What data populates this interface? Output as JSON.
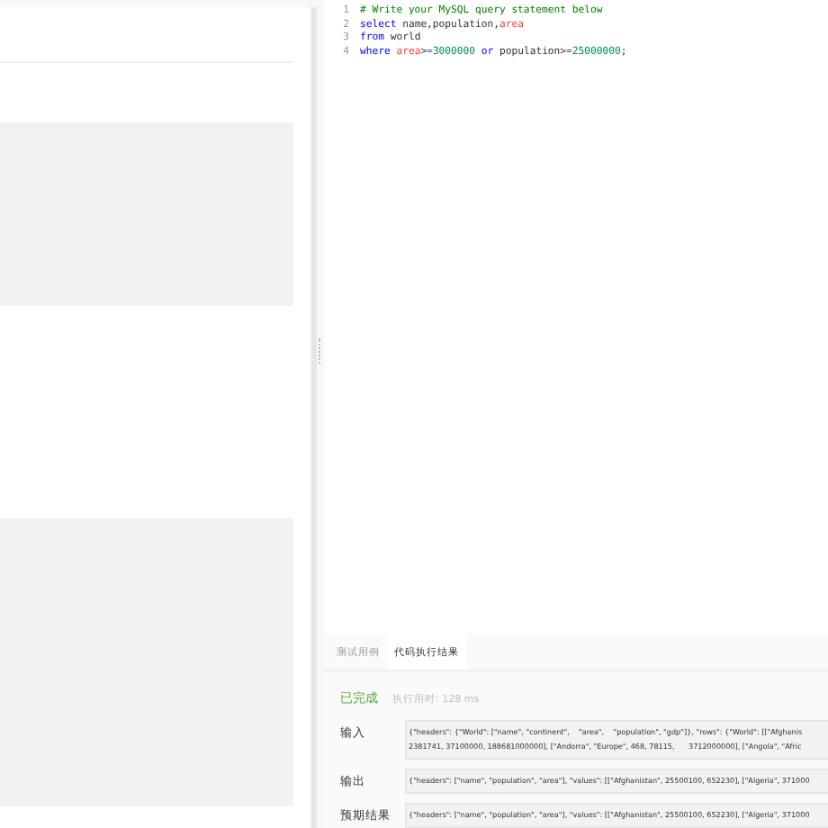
{
  "editor": {
    "lines": [
      {
        "number": "1",
        "tokens": [
          {
            "kind": "comment",
            "text": "# Write your MySQL query statement below"
          }
        ]
      },
      {
        "number": "2",
        "tokens": [
          {
            "kind": "keyword",
            "text": "select"
          },
          {
            "kind": "plain",
            "text": " name,population,"
          },
          {
            "kind": "column",
            "text": "area"
          }
        ]
      },
      {
        "number": "3",
        "tokens": [
          {
            "kind": "keyword",
            "text": "from"
          },
          {
            "kind": "plain",
            "text": " world"
          }
        ]
      },
      {
        "number": "4",
        "tokens": [
          {
            "kind": "keyword",
            "text": "where"
          },
          {
            "kind": "column",
            "text": " area"
          },
          {
            "kind": "plain",
            "text": ">="
          },
          {
            "kind": "number",
            "text": "3000000"
          },
          {
            "kind": "keyword",
            "text": " or"
          },
          {
            "kind": "plain",
            "text": " population>="
          },
          {
            "kind": "number",
            "text": "25000000"
          },
          {
            "kind": "plain",
            "text": ";"
          }
        ]
      }
    ]
  },
  "result_panel": {
    "tabs": [
      {
        "label": "测试用例",
        "selected": false
      },
      {
        "label": "代码执行结果",
        "selected": true
      }
    ],
    "status": "已完成",
    "runtime": "执行用时: 128 ms",
    "rows": [
      {
        "label": "输入",
        "lines": [
          "{\"headers\": {\"World\": [\"name\", \"continent\",    \"area\",    \"population\", \"gdp\"]}, \"rows\": {\"World\": [[\"Afghanis",
          "2381741, 37100000, 188681000000], [\"Andorra\", \"Europe\", 468, 78115,      3712000000], [\"Angola\", \"Afric"
        ]
      },
      {
        "label": "输出",
        "lines": [
          "{\"headers\": [\"name\", \"population\", \"area\"], \"values\": [[\"Afghanistan\", 25500100, 652230], [\"Algeria\", 371000"
        ]
      },
      {
        "label": "预期结果",
        "lines": [
          "{\"headers\": [\"name\", \"population\", \"area\"], \"values\": [[\"Afghanistan\", 25500100, 652230], [\"Algeria\", 371000"
        ]
      }
    ]
  }
}
